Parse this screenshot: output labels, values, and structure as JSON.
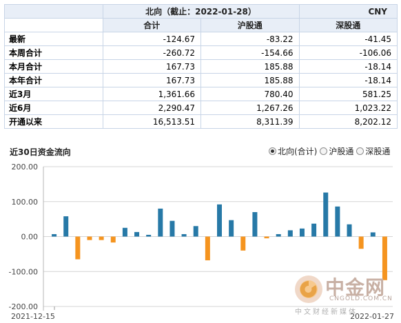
{
  "table": {
    "title": "北向（截止：2022-01-28）",
    "currency": "CNY",
    "columns": [
      "合计",
      "沪股通",
      "深股通"
    ],
    "rows": [
      {
        "label": "最新",
        "values": [
          "-124.67",
          "-83.22",
          "-41.45"
        ]
      },
      {
        "label": "本周合计",
        "values": [
          "-260.72",
          "-154.66",
          "-106.06"
        ]
      },
      {
        "label": "本月合计",
        "values": [
          "167.73",
          "185.88",
          "-18.14"
        ]
      },
      {
        "label": "本年合计",
        "values": [
          "167.73",
          "185.88",
          "-18.14"
        ]
      },
      {
        "label": "近3月",
        "values": [
          "1,361.66",
          "780.40",
          "581.25"
        ]
      },
      {
        "label": "近6月",
        "values": [
          "2,290.47",
          "1,267.26",
          "1,023.22"
        ]
      },
      {
        "label": "开通以来",
        "values": [
          "16,513.51",
          "8,311.39",
          "8,202.12"
        ]
      }
    ]
  },
  "chart": {
    "title": "近30日资金流向",
    "options": [
      {
        "label": "北向(合计)",
        "selected": true
      },
      {
        "label": "沪股通",
        "selected": false
      },
      {
        "label": "深股通",
        "selected": false
      }
    ]
  },
  "chart_data": {
    "type": "bar",
    "ylim": [
      -200,
      200
    ],
    "yticks": [
      "200.00",
      "100.00",
      "0.00",
      "-100.00",
      "-200.00"
    ],
    "x_start_label": "2021-12-15",
    "x_end_label": "2022-01-27",
    "colors": {
      "positive": "#2779a7",
      "negative": "#f5941f"
    },
    "values": [
      7,
      58,
      -65,
      -10,
      -10,
      -17,
      25,
      13,
      5,
      80,
      45,
      7,
      30,
      -68,
      92,
      47,
      -40,
      70,
      -5,
      7,
      18,
      23,
      37,
      126,
      86,
      35,
      -35,
      12,
      -124.67
    ]
  },
  "watermark": {
    "brand": "中金网",
    "domain": "CNGOLD.COM.CN",
    "slogan": "中文财经新媒体"
  }
}
